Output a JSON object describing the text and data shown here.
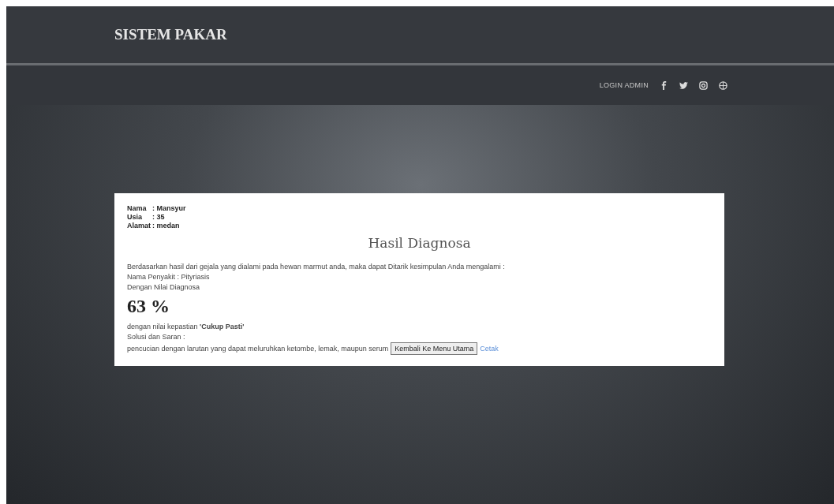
{
  "header": {
    "brand": "SISTEM PAKAR"
  },
  "nav": {
    "login": "LOGIN ADMIN"
  },
  "patient": [
    {
      "label": "Nama",
      "value": ": Mansyur"
    },
    {
      "label": "Usia",
      "value": ": 35"
    },
    {
      "label": "Alamat",
      "value": ": medan"
    }
  ],
  "title": "Hasil Diagnosa",
  "intro": "Berdasarkan hasil dari gejala yang dialami pada hewan marmut anda, maka dapat Ditarik kesimpulan Anda mengalami :",
  "disease": "Nama Penyakit : Pityriasis",
  "score_label": "Dengan Nilai Diagnosa",
  "score": "63 %",
  "certainty": "dengan nilai kepastian **'Cukup Pasti'**",
  "solution_label": "Solusi dan Saran :",
  "solution": "pencucian dengan larutan yang dapat meluruhkan ketombe, lemak, maupun serum",
  "back_button": "Kembali Ke Menu Utama",
  "print_link": "Cetak"
}
